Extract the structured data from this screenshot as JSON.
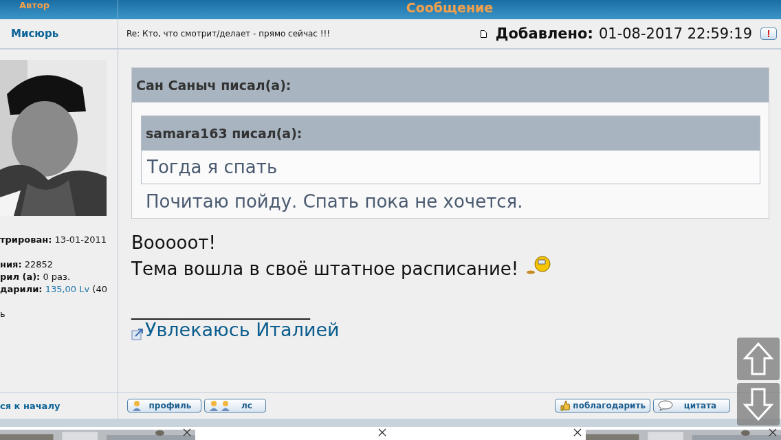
{
  "header": {
    "author_label": "Автор",
    "message_label": "Сообщение"
  },
  "post": {
    "author": "Мисюрь",
    "subject": "Re: Кто, что смотрит/делает - прямо сейчас !!!",
    "added_label": "Добавлено:",
    "added_value": "01-08-2017 22:59:19",
    "report": "!"
  },
  "profile": {
    "avatar": {
      "kind": "picture"
    },
    "fields": [
      {
        "kind": "field",
        "label": "трирован:",
        "value": "13-01-2011"
      },
      {
        "kind": "gap"
      },
      {
        "kind": "field",
        "label": "ния:",
        "value": "22852"
      },
      {
        "kind": "field",
        "label": "рил (а):",
        "value": "0 раз."
      },
      {
        "kind": "link",
        "label": "дарили:",
        "value": "135,00 Lv",
        "tail": "(40"
      },
      {
        "kind": "gap"
      },
      {
        "kind": "plain",
        "value": "ь"
      }
    ],
    "back_to_top": "ся к началу"
  },
  "quote": {
    "author": "Сан Саныч писал(а):",
    "nested": {
      "author": "samara163 писал(а):",
      "text": "Тогда я спать"
    },
    "text": "Почитаю пойду. Спать пока не хочется."
  },
  "body": {
    "lines": [
      "Вооооот!",
      "Тема вошла в своё штатное расписание!"
    ],
    "signature_rule": "____________________",
    "signature_link": "Увлекаюсь Италией"
  },
  "buttons_left": [
    {
      "kind": "profile",
      "label": "профиль"
    },
    {
      "kind": "pm",
      "label": "лс"
    }
  ],
  "buttons_right": [
    {
      "kind": "thanks",
      "label": "поблагодарить"
    },
    {
      "kind": "quote",
      "label": "цитата"
    }
  ],
  "ads": [
    {
      "kind": "picture"
    },
    {
      "kind": "empty"
    },
    {
      "kind": "empty"
    },
    {
      "kind": "picture"
    }
  ]
}
